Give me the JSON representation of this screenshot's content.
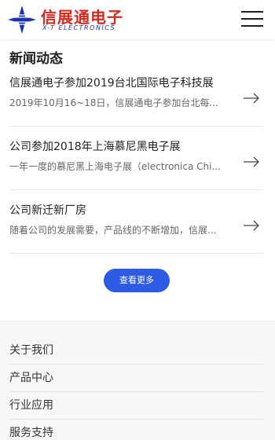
{
  "header": {
    "logo_cn": "信展通电子",
    "logo_en": "X-T ELECTRONICS",
    "menu_icon": "hamburger-menu-icon"
  },
  "news": {
    "section_title": "新闻动态",
    "items": [
      {
        "title": "信展通电子参加2019台北国际电子科技展",
        "desc": "2019年10月16~18日，信展通电子参加台北每..."
      },
      {
        "title": "公司参加2018年上海慕尼黑电子展",
        "desc": "一年一度的慕尼黑上海电子展（electronica Chi..."
      },
      {
        "title": "公司新迁新厂房",
        "desc": "随着公司的发展需要，产品线的不断增加，信展..."
      }
    ],
    "arrow_icon": "arrow-right-icon",
    "more_label": "查看更多",
    "accent_color": "#2d5be3"
  },
  "footer": {
    "items": [
      {
        "label": "关于我们"
      },
      {
        "label": "产品中心"
      },
      {
        "label": "行业应用"
      },
      {
        "label": "服务支持"
      }
    ]
  }
}
